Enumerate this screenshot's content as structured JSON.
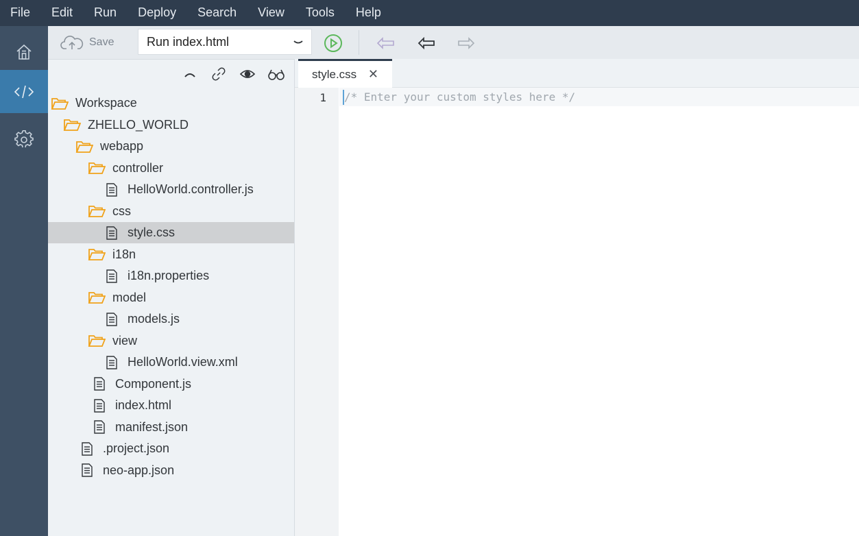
{
  "menu": [
    "File",
    "Edit",
    "Run",
    "Deploy",
    "Search",
    "View",
    "Tools",
    "Help"
  ],
  "sidebar": {
    "items": [
      {
        "name": "home-icon"
      },
      {
        "name": "code-icon",
        "active": true
      },
      {
        "name": "gear-icon"
      }
    ]
  },
  "toolbar": {
    "save_label": "Save",
    "run_config": "Run index.html"
  },
  "tree": {
    "nodes": [
      {
        "label": "Workspace",
        "type": "folder",
        "depth": 0
      },
      {
        "label": "ZHELLO_WORLD",
        "type": "folder",
        "depth": 1
      },
      {
        "label": "webapp",
        "type": "folder",
        "depth": 2
      },
      {
        "label": "controller",
        "type": "folder",
        "depth": 3
      },
      {
        "label": "HelloWorld.controller.js",
        "type": "file",
        "depth": 4
      },
      {
        "label": "css",
        "type": "folder",
        "depth": 3
      },
      {
        "label": "style.css",
        "type": "file",
        "depth": 4,
        "selected": true
      },
      {
        "label": "i18n",
        "type": "folder",
        "depth": 3
      },
      {
        "label": "i18n.properties",
        "type": "file",
        "depth": 4
      },
      {
        "label": "model",
        "type": "folder",
        "depth": 3
      },
      {
        "label": "models.js",
        "type": "file",
        "depth": 4
      },
      {
        "label": "view",
        "type": "folder",
        "depth": 3
      },
      {
        "label": "HelloWorld.view.xml",
        "type": "file",
        "depth": 4
      },
      {
        "label": "Component.js",
        "type": "file",
        "depth": 3
      },
      {
        "label": "index.html",
        "type": "file",
        "depth": 3
      },
      {
        "label": "manifest.json",
        "type": "file",
        "depth": 3
      },
      {
        "label": ".project.json",
        "type": "file",
        "depth": 2
      },
      {
        "label": "neo-app.json",
        "type": "file",
        "depth": 2
      }
    ]
  },
  "editor": {
    "tab_label": "style.css",
    "close_glyph": "✕",
    "line_number": "1",
    "code_line": "/* Enter your custom styles here */"
  },
  "colors": {
    "menubar": "#2f3d4e",
    "sidebar": "#3e5064",
    "sidebar_active": "#3a7bab",
    "folder": "#f0a21a",
    "run_green": "#5cb85c"
  }
}
